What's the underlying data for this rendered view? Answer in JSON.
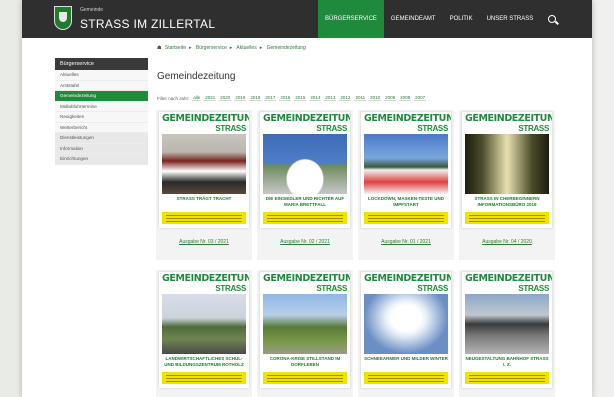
{
  "header": {
    "brand_small": "Gemeinde",
    "brand_title": "STRASS IM ZILLERTAL",
    "nav": [
      "BÜRGERSERVICE",
      "GEMEINDEAMT",
      "POLITIK",
      "UNSER STRASS"
    ],
    "active_nav": 0,
    "search_icon": "search-icon"
  },
  "sidebar": {
    "title": "Bürgerservice",
    "items": [
      "Aktuelles",
      "Amtstafel",
      "Gemeindezeitung",
      "Müllabfuhrtermine",
      "Neuigkeiten",
      "Wetterbericht",
      "Dienstleistungen",
      "Information",
      "Einrichtungen"
    ],
    "active_index": 2
  },
  "breadcrumb": [
    "Startseite",
    "Bürgerservice",
    "Aktuelles",
    "Gemeindezeitung"
  ],
  "main": {
    "title": "Gemeindezeitung",
    "filter_label": "Filter nach Jahr:",
    "years": [
      "alle",
      "2021",
      "2020",
      "2019",
      "2018",
      "2017",
      "2016",
      "2015",
      "2014",
      "2013",
      "2012",
      "2011",
      "2010",
      "2009",
      "2008",
      "2007"
    ]
  },
  "newspapers": [
    {
      "masthead": "GEMEINDEZEITUNG",
      "place": "STRASS",
      "headline": "STRASS TRÄGT TRACHT",
      "link": "Ausgabe Nr. 03 / 2021"
    },
    {
      "masthead": "GEMEINDEZEITUNG",
      "place": "STRASS",
      "headline": "DIE EINSIEDLER UND RICHTER AUF MARIA BRETTFALL",
      "link": "Ausgabe Nr. 02 / 2021"
    },
    {
      "masthead": "GEMEINDEZEITUNG",
      "place": "STRASS",
      "headline": "LOCKDOWN, MASKEN-TESTE UND IMPFSTART",
      "link": "Ausgabe Nr. 01 / 2021"
    },
    {
      "masthead": "GEMEINDEZEITUNG",
      "place": "STRASS",
      "headline": "STRASS IN CHERBEGINNERN INFORMATIONSBÜRO 2019",
      "link": "Ausgabe Nr. 04 / 2020"
    },
    {
      "masthead": "GEMEINDEZEITUNG",
      "place": "STRASS",
      "headline": "LANDWIRTSCHAFTLICHES SCHUL- UND BILDUNGSZENTRUM ROTHOLZ",
      "link": ""
    },
    {
      "masthead": "GEMEINDEZEITUNG",
      "place": "STRASS",
      "headline": "CORONA-KRISE STILLSTAND IM DORFLEBEN",
      "link": ""
    },
    {
      "masthead": "GEMEINDEZEITUNG",
      "place": "STRASS",
      "headline": "SCHNEEARMER UND MILDER WINTER",
      "link": ""
    },
    {
      "masthead": "GEMEINDEZEITUNG",
      "place": "STRASS",
      "headline": "NEUGESTALTUNG BAHNHOF STRASS I. Z.",
      "link": ""
    }
  ],
  "colors": {
    "accent": "#1f8a3c",
    "topbar": "#2f2f2f",
    "cover_yellow": "#f2e200"
  }
}
